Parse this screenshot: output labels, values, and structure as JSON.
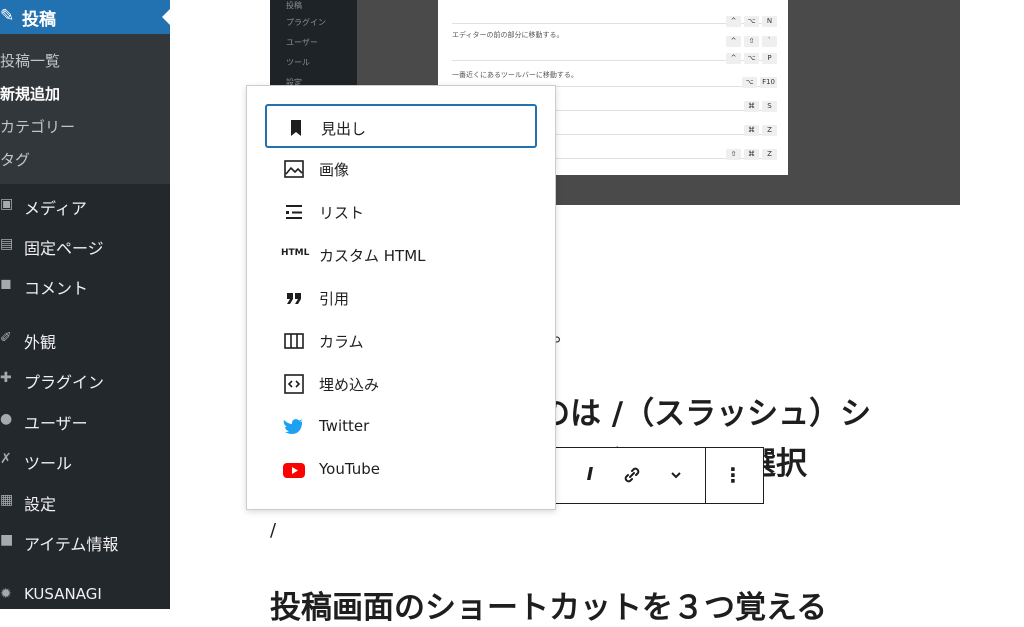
{
  "sidebar": {
    "top_item": "投稿",
    "submenu": [
      "投稿一覧",
      "新規追加",
      "カテゴリー",
      "タグ"
    ],
    "items": [
      "メディア",
      "固定ページ",
      "コメント",
      "外観",
      "プラグイン",
      "ユーザー",
      "ツール",
      "設定",
      "アイテム情報",
      "KUSANAGI"
    ]
  },
  "shot": {
    "side_items": [
      "投稿",
      "プラグイン",
      "ユーザー",
      "ツール",
      "設定"
    ],
    "rows": [
      {
        "text": "",
        "keys": [
          "^",
          "⌥",
          "N"
        ]
      },
      {
        "text": "エディターの前の部分に移動する。",
        "keys": [
          "^",
          "⇧",
          "`"
        ]
      },
      {
        "text": "",
        "keys": [
          "^",
          "⌥",
          "P"
        ]
      },
      {
        "text": "一番近くにあるツールバーに移動する。",
        "keys": [
          "⌥",
          "F10"
        ]
      },
      {
        "text": "",
        "keys": [
          "⌘",
          "S"
        ]
      },
      {
        "text": "",
        "keys": [
          "⌘",
          "Z"
        ]
      },
      {
        "text": "",
        "keys": [
          "⇧",
          "⌘",
          "Z"
        ]
      }
    ]
  },
  "editor": {
    "period": "。",
    "heading1_line1": "いのは /（スラッシュ）シ",
    "heading1_line2": "ブロックを選択",
    "slash": "/",
    "heading2": "投稿画面のショートカットを３つ覚える"
  },
  "toolbar": {
    "italic": "I",
    "more": "⋮"
  },
  "popup": {
    "options": [
      {
        "label": "見出し",
        "icon": "bookmark-icon"
      },
      {
        "label": "画像",
        "icon": "image-icon"
      },
      {
        "label": "リスト",
        "icon": "list-icon"
      },
      {
        "label": "カスタム HTML",
        "icon": "html-icon",
        "icon_text": "HTML"
      },
      {
        "label": "引用",
        "icon": "quote-icon"
      },
      {
        "label": "カラム",
        "icon": "columns-icon"
      },
      {
        "label": "埋め込み",
        "icon": "embed-icon"
      },
      {
        "label": "Twitter",
        "icon": "twitter-icon"
      },
      {
        "label": "YouTube",
        "icon": "youtube-icon"
      }
    ]
  },
  "colors": {
    "accent": "#2271b1",
    "sidebar": "#23282d",
    "twitter": "#1da1f2",
    "youtube": "#ff0000"
  }
}
